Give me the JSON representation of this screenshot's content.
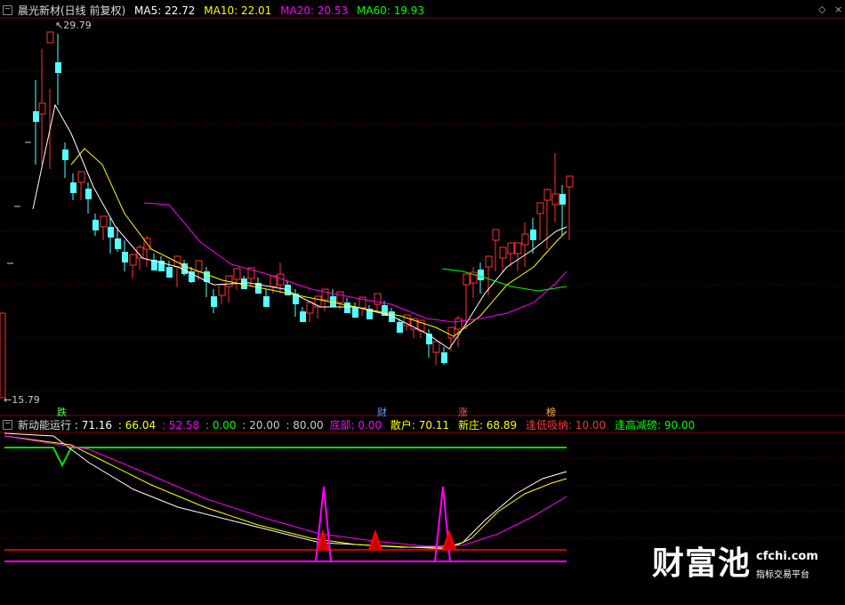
{
  "main_header": {
    "title": "晨光新材(日线 前复权)",
    "ma5": "MA5: 22.72",
    "ma10": "MA10: 22.01",
    "ma20": "MA20: 20.53",
    "ma60": "MA60: 19.93"
  },
  "price_markers": {
    "high": "29.79",
    "low": "15.79"
  },
  "event_markers": [
    "跌",
    "财",
    "涨",
    "榜"
  ],
  "indicator_header": {
    "name": "新动能运行",
    "v1": ": 71.16",
    "v2": ": 66.04",
    "v3": ": 52.58",
    "v4": ": 0.00",
    "v5": ": 20.00",
    "v6": ": 80.00",
    "bottom": "底部: 0.00",
    "retail": "散户: 70.11",
    "newbanker": "新庄: 68.89",
    "buy_low": "逢低吸纳: 10.00",
    "sell_high": "逢高减磅: 90.00"
  },
  "watermark": {
    "brand": "财富池",
    "domain": "cfchi.com",
    "tagline": "指标交易平台"
  },
  "colors": {
    "up": "#ff3232",
    "down": "#54ffff",
    "ma5": "#ffffff",
    "ma10": "#ffff00",
    "ma20": "#ff00ff",
    "ma60": "#00ff00",
    "grid": "#7a0000",
    "panel_border": "#8b0000"
  }
}
